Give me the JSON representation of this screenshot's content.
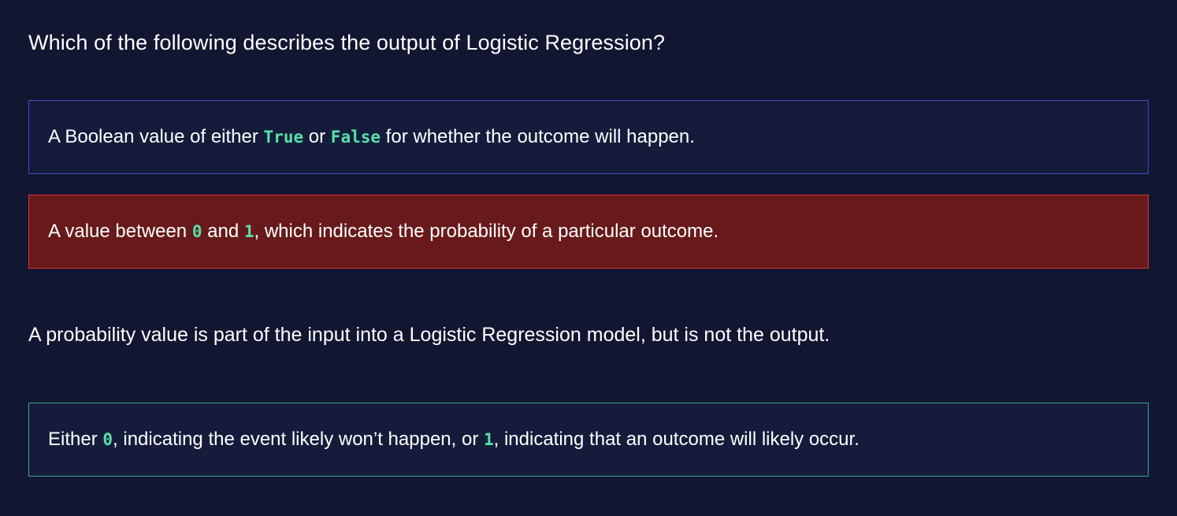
{
  "question": {
    "text": "Which of the following describes the output of Logistic Regression?"
  },
  "options": [
    {
      "state": "neutral",
      "parts": [
        "A Boolean value of either ",
        "True",
        " or ",
        "False",
        " for whether the outcome will happen."
      ]
    },
    {
      "state": "incorrect",
      "parts": [
        "A value between ",
        "0",
        " and ",
        "1",
        ", which indicates the probability of a particular outcome."
      ]
    },
    {
      "state": "correct",
      "parts": [
        "Either ",
        "0",
        ", indicating the event likely won’t happen, or ",
        "1",
        ", indicating that an outcome will likely occur."
      ]
    }
  ],
  "feedback": {
    "text": "A probability value is part of the input into a Logistic Regression model, but is not the output."
  },
  "colors": {
    "background": "#121631",
    "option_bg": "#151c3b",
    "neutral_border": "#3b4fc8",
    "incorrect_bg": "#681a1b",
    "incorrect_border": "#d23a2f",
    "correct_border": "#3aa38f",
    "code_text": "#57e0a8"
  }
}
